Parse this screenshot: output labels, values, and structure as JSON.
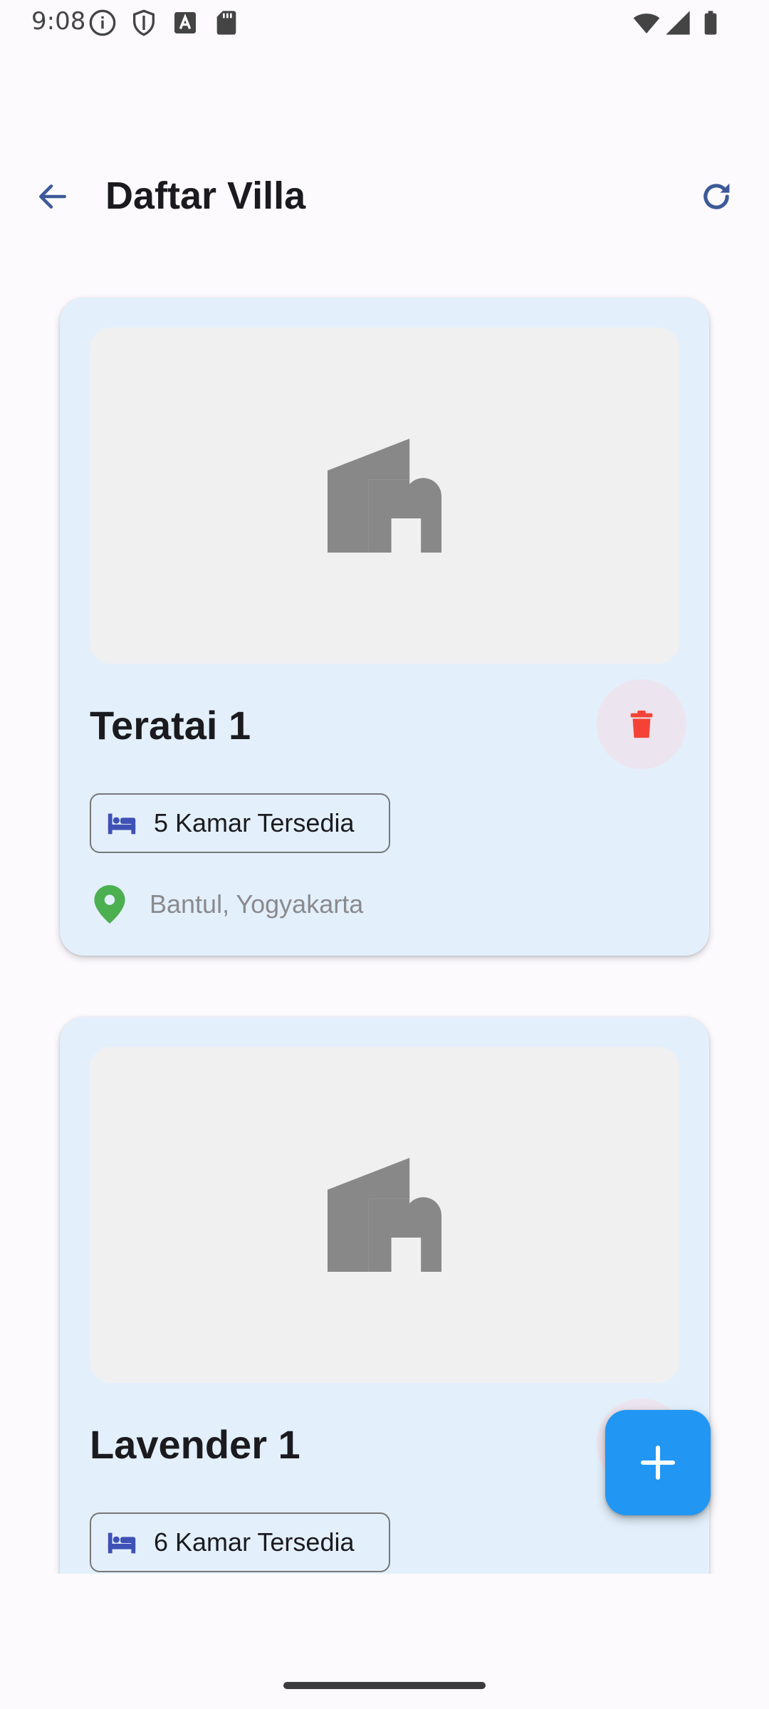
{
  "status_bar": {
    "time": "9:08",
    "icons": [
      "info-icon",
      "shield-icon",
      "font-icon",
      "sd-card-icon",
      "wifi-icon",
      "cell-signal-icon",
      "battery-icon"
    ]
  },
  "app_bar": {
    "title": "Daftar Villa",
    "back_icon": "arrow-back-icon",
    "refresh_icon": "refresh-icon"
  },
  "villas": [
    {
      "name": "Teratai 1",
      "rooms": "5 Kamar Tersedia",
      "location": "Bantul, Yogyakarta"
    },
    {
      "name": "Lavender 1",
      "rooms": "6 Kamar Tersedia",
      "location": ""
    }
  ],
  "fab": {
    "icon": "add-icon"
  },
  "colors": {
    "primary": "#2196f3",
    "card_background": "#e3f0fb",
    "delete": "#f44336",
    "location_pin": "#4caf50",
    "bed_icon": "#3f51b5",
    "placeholder_icon": "#888888",
    "app_bar_icon": "#3d5a98"
  }
}
